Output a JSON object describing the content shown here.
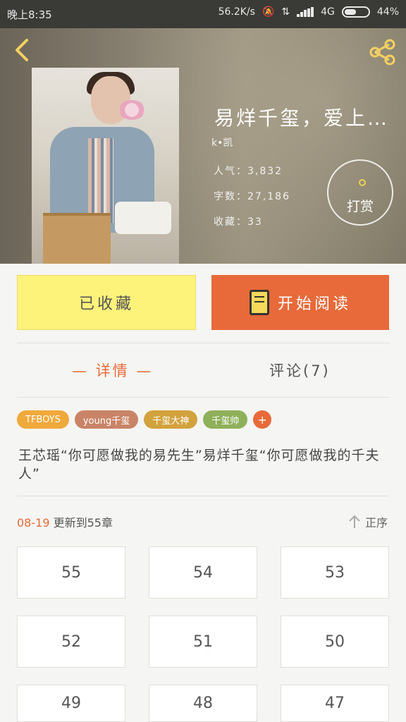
{
  "status_bar": {
    "time": "晚上8:35",
    "net_speed": "56.2K/s",
    "network": "4G",
    "battery": "44%"
  },
  "book": {
    "title": "易烊千玺，爱上…",
    "author": "k•凯",
    "popularity": "人气：3,832",
    "word_count": "字数：27,186",
    "favorites": "收藏：33"
  },
  "actions": {
    "reward_label": "打赏",
    "saved_label": "已收藏",
    "read_label": "开始阅读"
  },
  "tabs": {
    "detail": "— 详情 —",
    "comments": "评论(7)"
  },
  "tags": [
    {
      "label": "TFBOYS",
      "color": "#f0a93b"
    },
    {
      "label": "young千玺",
      "color": "#c98467"
    },
    {
      "label": "千玺大神",
      "color": "#d2a23d"
    },
    {
      "label": "千玺帅",
      "color": "#8fb05a"
    },
    {
      "label": "+",
      "color": "#e86a3a"
    }
  ],
  "description": "王芯瑶“你可愿做我的易先生”易烊千玺“你可愿做我的千夫人”",
  "update": {
    "date": "08-19",
    "text": " 更新到55章"
  },
  "order_label": "正序",
  "chapters": [
    "55",
    "54",
    "53",
    "52",
    "51",
    "50",
    "49",
    "48",
    "47"
  ]
}
